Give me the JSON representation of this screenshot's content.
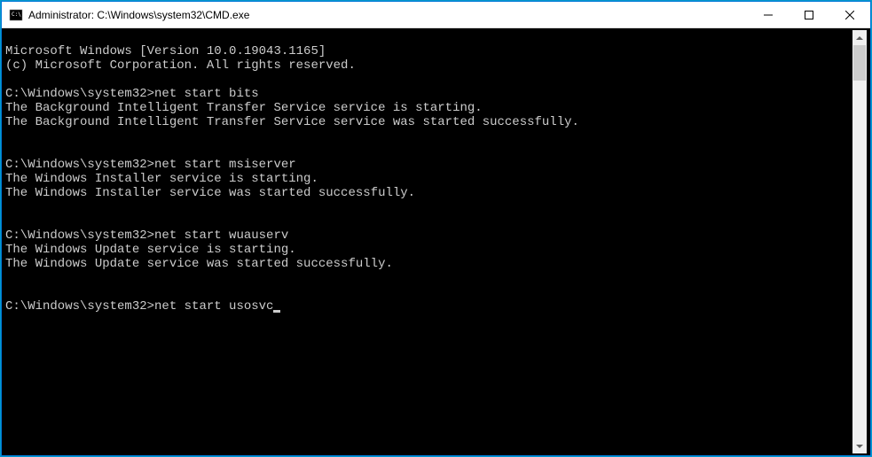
{
  "titlebar": {
    "title": "Administrator: C:\\Windows\\system32\\CMD.exe"
  },
  "terminal": {
    "header1": "Microsoft Windows [Version 10.0.19043.1165]",
    "header2": "(c) Microsoft Corporation. All rights reserved.",
    "prompt": "C:\\Windows\\system32>",
    "cmd1": "net start bits",
    "out1a": "The Background Intelligent Transfer Service service is starting.",
    "out1b": "The Background Intelligent Transfer Service service was started successfully.",
    "cmd2": "net start msiserver",
    "out2a": "The Windows Installer service is starting.",
    "out2b": "The Windows Installer service was started successfully.",
    "cmd3": "net start wuauserv",
    "out3a": "The Windows Update service is starting.",
    "out3b": "The Windows Update service was started successfully.",
    "cmd4": "net start usosvc"
  }
}
